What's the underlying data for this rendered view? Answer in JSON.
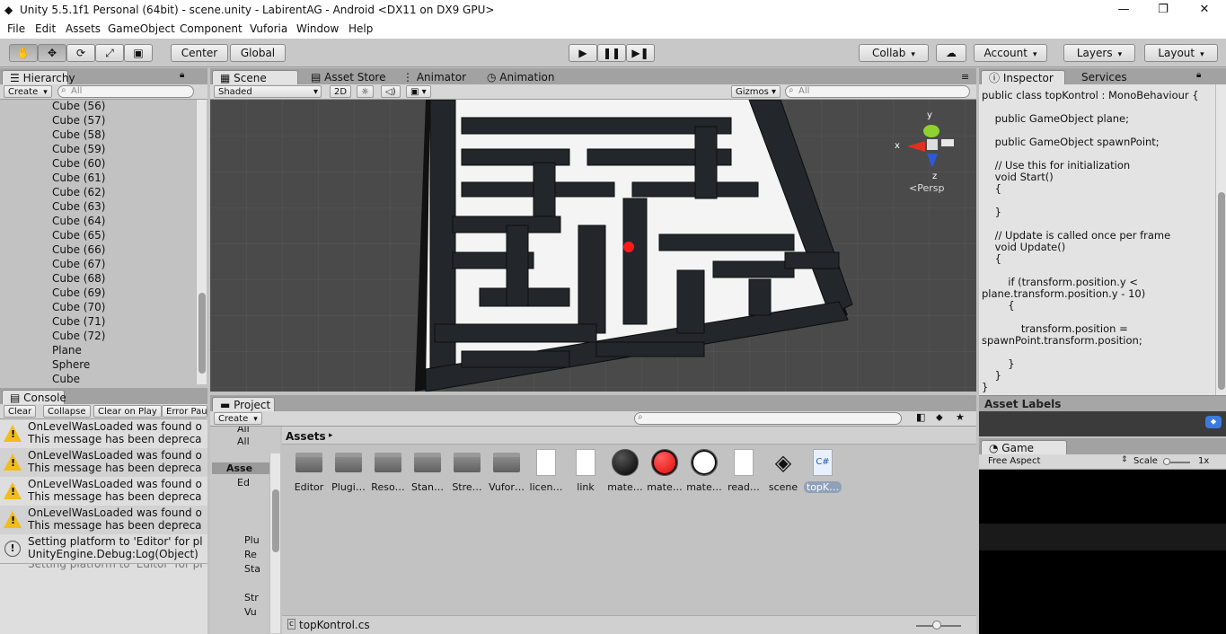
{
  "window": {
    "title": "Unity 5.5.1f1 Personal (64bit) - scene.unity - LabirentAG - Android <DX11 on DX9 GPU>",
    "minimize": "—",
    "maximize": "❐",
    "close": "✕"
  },
  "menu": [
    "File",
    "Edit",
    "Assets",
    "GameObject",
    "Component",
    "Vuforia",
    "Window",
    "Help"
  ],
  "toolbar": {
    "center": "Center",
    "global": "Global",
    "collab": "Collab",
    "account": "Account",
    "layers": "Layers",
    "layout": "Layout",
    "tools": [
      "hand-icon",
      "move-icon",
      "rotate-icon",
      "scale-icon",
      "rect-icon"
    ],
    "play": "▶",
    "pause": "❚❚",
    "step": "▶❚"
  },
  "hierarchy": {
    "tab": "Hierarchy",
    "create": "Create",
    "search_placeholder": "All",
    "items": [
      "Cube (56)",
      "Cube (57)",
      "Cube (58)",
      "Cube (59)",
      "Cube (60)",
      "Cube (61)",
      "Cube (62)",
      "Cube (63)",
      "Cube (64)",
      "Cube (65)",
      "Cube (66)",
      "Cube (67)",
      "Cube (68)",
      "Cube (69)",
      "Cube (70)",
      "Cube (71)",
      "Cube (72)",
      "Plane",
      "Sphere",
      "Cube"
    ]
  },
  "scene": {
    "tabs": [
      "Scene",
      "Asset Store",
      "Animator",
      "Animation"
    ],
    "shading": "Shaded",
    "mode2d": "2D",
    "gizmos": "Gizmos",
    "search_placeholder": "All",
    "persp": "<Persp",
    "axis_x": "x",
    "axis_y": "y",
    "axis_z": "z"
  },
  "console": {
    "tab": "Console",
    "buttons": [
      "Clear",
      "Collapse",
      "Clear on Play",
      "Error Pau"
    ],
    "messages": [
      {
        "type": "warning",
        "line1": "OnLevelWasLoaded was found o",
        "line2": "This message has been depreca"
      },
      {
        "type": "warning",
        "line1": "OnLevelWasLoaded was found o",
        "line2": "This message has been depreca"
      },
      {
        "type": "warning",
        "line1": "OnLevelWasLoaded was found o",
        "line2": "This message has been depreca"
      },
      {
        "type": "warning",
        "line1": "OnLevelWasLoaded was found o",
        "line2": "This message has been depreca"
      },
      {
        "type": "info",
        "line1": "Setting platform to 'Editor' for pl",
        "line2": "UnityEngine.Debug:Log(Object)"
      }
    ],
    "cut": "Setting platform to 'Editor' for pl"
  },
  "project": {
    "tab": "Project",
    "create": "Create",
    "breadcrumb": "Assets",
    "tree": [
      "All",
      "All",
      "Asse",
      "Ed",
      "Plu",
      "Re",
      "Sta",
      "Str",
      "Vu"
    ],
    "assets": [
      {
        "label": "Editor",
        "kind": "folder"
      },
      {
        "label": "Plugi…",
        "kind": "folder"
      },
      {
        "label": "Reso…",
        "kind": "folder"
      },
      {
        "label": "Stan…",
        "kind": "folder"
      },
      {
        "label": "Stre…",
        "kind": "folder"
      },
      {
        "label": "Vufor…",
        "kind": "folder"
      },
      {
        "label": "licen…",
        "kind": "doc"
      },
      {
        "label": "link",
        "kind": "doc"
      },
      {
        "label": "mate…",
        "kind": "ball-black"
      },
      {
        "label": "mate…",
        "kind": "ball-red"
      },
      {
        "label": "mate…",
        "kind": "ball-white"
      },
      {
        "label": "read…",
        "kind": "doc"
      },
      {
        "label": "scene",
        "kind": "unity"
      },
      {
        "label": "topK…",
        "kind": "cs"
      }
    ],
    "status_file": "topKontrol.cs",
    "cs_badge": "C#"
  },
  "inspector": {
    "tabs": [
      "Inspector",
      "Services"
    ],
    "code": [
      "public class topKontrol : MonoBehaviour {",
      "",
      "    public GameObject plane;",
      "",
      "    public GameObject spawnPoint;",
      "",
      "    // Use this for initialization",
      "    void Start()",
      "    {",
      "",
      "    }",
      "",
      "    // Update is called once per frame",
      "    void Update()",
      "    {",
      "",
      "        if (transform.position.y <",
      "plane.transform.position.y - 10)",
      "        {",
      "",
      "            transform.position =",
      "spawnPoint.transform.position;",
      "",
      "        }",
      "    }",
      "}"
    ],
    "asset_labels": "Asset Labels"
  },
  "game": {
    "tab": "Game",
    "aspect": "Free Aspect",
    "scale_label": "Scale",
    "scale_value": "1x"
  },
  "colors": {
    "accent_red": "#ff1a1a",
    "maze_wall": "#1e2124",
    "play_bg": "#d8d8d8"
  }
}
